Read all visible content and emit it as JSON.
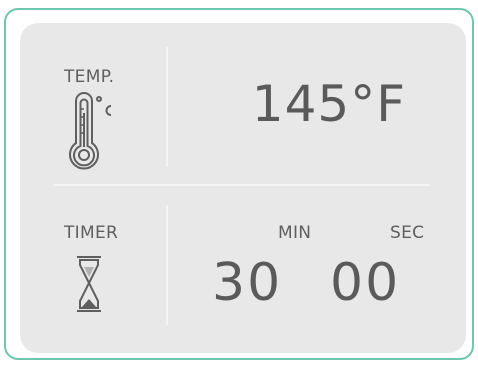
{
  "temperature": {
    "label": "TEMP.",
    "icon": "thermometer-celsius-icon",
    "value": "145°F"
  },
  "timer": {
    "label": "TIMER",
    "icon": "hourglass-icon",
    "min_label": "MIN",
    "sec_label": "SEC",
    "minutes": "30",
    "seconds": "00"
  },
  "colors": {
    "frame_border": "#6cc7ad",
    "panel_bg": "#e8e8e8",
    "text": "#5a5a5a"
  }
}
